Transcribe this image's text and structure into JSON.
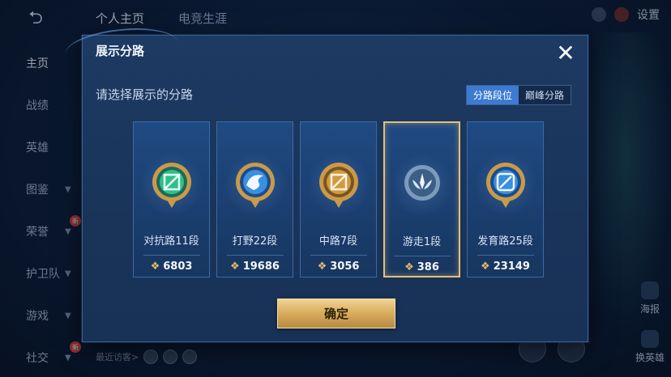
{
  "header": {
    "back_icon": "back-arrow-icon",
    "tabs": [
      "个人主页",
      "电竞生涯"
    ],
    "settings_label": "设置"
  },
  "sidebar": {
    "items": [
      {
        "label": "主页",
        "active": true,
        "chevron": false,
        "badge": ""
      },
      {
        "label": "战绩",
        "active": false,
        "chevron": false,
        "badge": ""
      },
      {
        "label": "英雄",
        "active": false,
        "chevron": false,
        "badge": ""
      },
      {
        "label": "图鉴",
        "active": false,
        "chevron": true,
        "badge": ""
      },
      {
        "label": "荣誉",
        "active": false,
        "chevron": true,
        "badge": "新"
      },
      {
        "label": "护卫队",
        "active": false,
        "chevron": true,
        "badge": ""
      },
      {
        "label": "游戏",
        "active": false,
        "chevron": true,
        "badge": ""
      },
      {
        "label": "社交",
        "active": false,
        "chevron": true,
        "badge": "新"
      }
    ]
  },
  "visitors": {
    "label": "最近访客>"
  },
  "right_actions": {
    "poster": "海报",
    "change_hero": "换英雄"
  },
  "modal": {
    "title": "展示分路",
    "close_icon": "close-x-icon",
    "prompt": "请选择展示的分路",
    "segments": [
      {
        "label": "分路段位",
        "active": true
      },
      {
        "label": "巅峰分路",
        "active": false
      }
    ],
    "lanes": [
      {
        "name": "对抗路11段",
        "score": "6803",
        "icon": "clash-lane-emblem-icon",
        "gem": "#2fbf8a",
        "selected": false
      },
      {
        "name": "打野22段",
        "score": "19686",
        "icon": "jungle-emblem-icon",
        "gem": "#3a8fe0",
        "selected": false
      },
      {
        "name": "中路7段",
        "score": "3056",
        "icon": "mid-lane-emblem-icon",
        "gem": "#d09a42",
        "selected": false
      },
      {
        "name": "游走1段",
        "score": "386",
        "icon": "roam-emblem-icon",
        "gem": "#8fb6d8",
        "selected": true
      },
      {
        "name": "发育路25段",
        "score": "23149",
        "icon": "farm-lane-emblem-icon",
        "gem": "#3a8fe0",
        "selected": false
      }
    ],
    "confirm_label": "确定"
  },
  "colors": {
    "accent_blue": "#3c7bd1",
    "gold": "#e2b86a",
    "selected_border": "#e6bf7a"
  }
}
